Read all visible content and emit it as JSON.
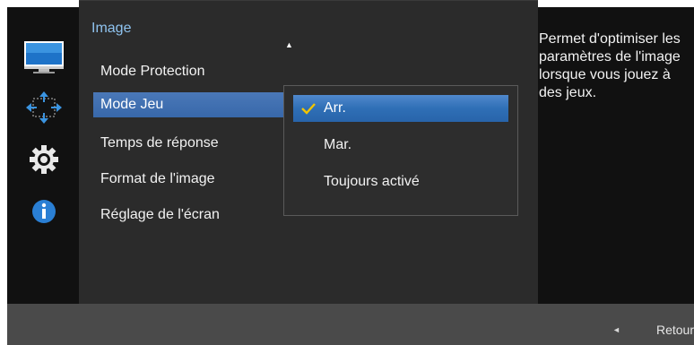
{
  "sidebar": {
    "icons": [
      "monitor-icon",
      "resize-arrows-icon",
      "gear-icon",
      "info-icon"
    ]
  },
  "panel": {
    "title": "Image",
    "items": [
      {
        "label": "Mode Protection"
      },
      {
        "label": "Mode Jeu",
        "selected": true
      },
      {
        "label": "Temps de réponse"
      },
      {
        "label": "Format de l'image"
      },
      {
        "label": "Réglage de l'écran"
      }
    ]
  },
  "submenu": {
    "options": [
      {
        "label": "Arr.",
        "selected": true
      },
      {
        "label": "Mar."
      },
      {
        "label": "Toujours activé"
      }
    ]
  },
  "help": {
    "text": "Permet d'optimiser les paramètres de l'image lorsque vous jouez à des jeux."
  },
  "footer": {
    "back_label": "Retour"
  },
  "colors": {
    "title": "#8fc3ef",
    "selection": "#3868aa",
    "check": "#f2c500"
  }
}
